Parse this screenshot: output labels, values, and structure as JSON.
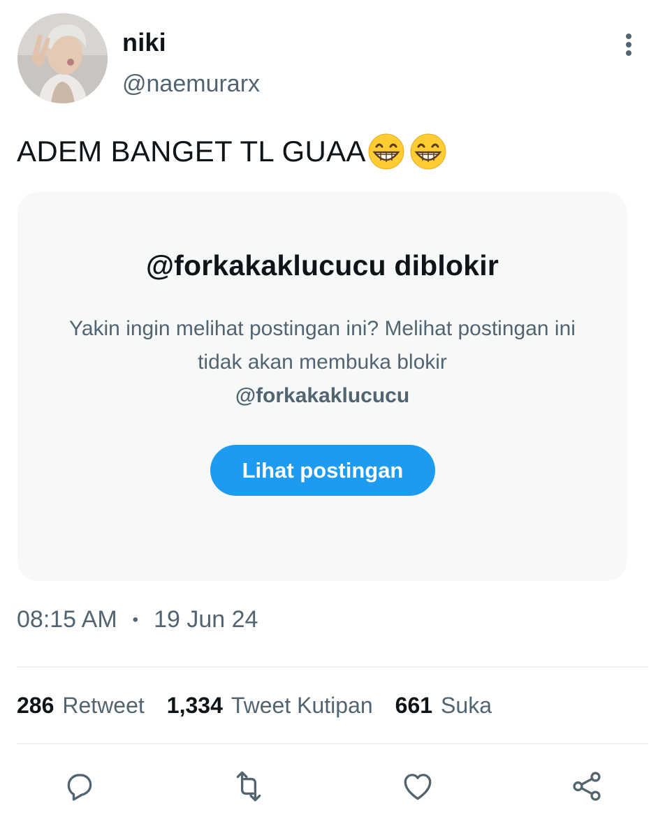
{
  "author": {
    "display_name": "niki",
    "handle": "@naemurarx"
  },
  "tweet": {
    "text": "ADEM BANGET TL GUAA",
    "emojis": [
      "grinning-face-with-smiling-eyes",
      "grinning-face-with-smiling-eyes"
    ]
  },
  "blocked_notice": {
    "title": "@forkakaklucucu diblokir",
    "description": "Yakin ingin melihat postingan ini? Melihat postingan ini tidak akan membuka blokir",
    "blocked_handle": "@forkakaklucucu",
    "button_label": "Lihat postingan"
  },
  "timestamp": {
    "time": "08:15 AM",
    "separator": "•",
    "date": "19 Jun 24"
  },
  "stats": [
    {
      "count": "286",
      "label": "Retweet"
    },
    {
      "count": "1,334",
      "label": "Tweet Kutipan"
    },
    {
      "count": "661",
      "label": "Suka"
    }
  ],
  "actions": [
    "reply-icon",
    "retweet-icon",
    "like-icon",
    "share-icon"
  ],
  "colors": {
    "accent": "#1d9bf0",
    "text_primary": "#0f1419",
    "text_secondary": "#536471",
    "card_background": "#f7f9f9",
    "divider": "#eff3f4"
  }
}
